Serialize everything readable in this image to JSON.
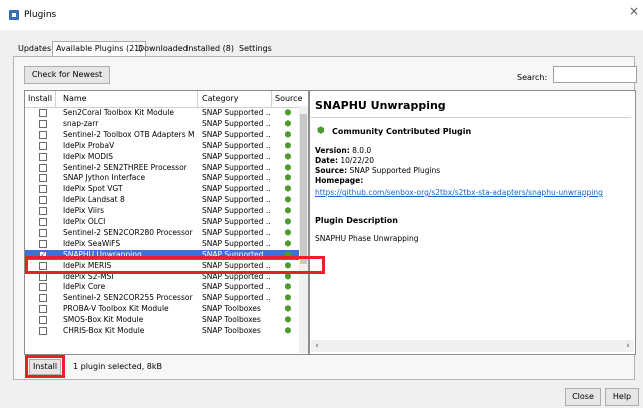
{
  "window": {
    "title": "Plugins",
    "close_glyph": "×"
  },
  "tabs": [
    {
      "label": "Updates"
    },
    {
      "label": "Available Plugins (21)"
    },
    {
      "label": "Downloaded"
    },
    {
      "label": "Installed (8)"
    },
    {
      "label": "Settings"
    }
  ],
  "toolbar": {
    "check_label": "Check for Newest",
    "search_label": "Search:",
    "search_value": ""
  },
  "table": {
    "headers": {
      "install": "Install",
      "name": "Name",
      "category": "Category",
      "source": "Source"
    },
    "rows": [
      {
        "name": "Sen2Coral Toolbox Kit Module",
        "category": "SNAP Supported ...",
        "checked": false
      },
      {
        "name": "snap-zarr",
        "category": "SNAP Supported ...",
        "checked": false
      },
      {
        "name": "Sentinel-2 Toolbox OTB Adapters M...",
        "category": "SNAP Supported ...",
        "checked": false
      },
      {
        "name": "IdePix ProbaV",
        "category": "SNAP Supported ...",
        "checked": false
      },
      {
        "name": "IdePix MODIS",
        "category": "SNAP Supported ...",
        "checked": false
      },
      {
        "name": "Sentinel-2 SEN2THREE Processor",
        "category": "SNAP Supported ...",
        "checked": false
      },
      {
        "name": "SNAP Jython Interface",
        "category": "SNAP Supported ...",
        "checked": false
      },
      {
        "name": "IdePix Spot VGT",
        "category": "SNAP Supported ...",
        "checked": false
      },
      {
        "name": "IdePix Landsat 8",
        "category": "SNAP Supported ...",
        "checked": false
      },
      {
        "name": "IdePix Viirs",
        "category": "SNAP Supported ...",
        "checked": false
      },
      {
        "name": "IdePix OLCI",
        "category": "SNAP Supported ...",
        "checked": false
      },
      {
        "name": "Sentinel-2 SEN2COR280 Processor",
        "category": "SNAP Supported ...",
        "checked": false
      },
      {
        "name": "IdePix SeaWiFS",
        "category": "SNAP Supported ...",
        "checked": false
      },
      {
        "name": "SNAPHU Unwrapping",
        "category": "SNAP Supported ...",
        "checked": true,
        "selected": true
      },
      {
        "name": "IdePix MERIS",
        "category": "SNAP Supported ...",
        "checked": false
      },
      {
        "name": "IdePix S2-MSI",
        "category": "SNAP Supported ...",
        "checked": false
      },
      {
        "name": "IdePix Core",
        "category": "SNAP Supported ...",
        "checked": false
      },
      {
        "name": "Sentinel-2 SEN2COR255 Processor",
        "category": "SNAP Supported ...",
        "checked": false
      },
      {
        "name": "PROBA-V Toolbox Kit Module",
        "category": "SNAP Toolboxes",
        "checked": false
      },
      {
        "name": "SMOS-Box Kit Module",
        "category": "SNAP Toolboxes",
        "checked": false
      },
      {
        "name": "CHRIS-Box Kit Module",
        "category": "SNAP Toolboxes",
        "checked": false
      }
    ]
  },
  "details": {
    "title": "SNAPHU Unwrapping",
    "contrib_label": "Community Contributed Plugin",
    "version_label": "Version:",
    "version": "8.0.0",
    "date_label": "Date:",
    "date": "10/22/20",
    "source_label": "Source:",
    "source": "SNAP Supported Plugins",
    "homepage_label": "Homepage:",
    "homepage_url": "https://github.com/senbox-org/s2tbx/s2tbx-sta-adapters/snaphu-unwrapping",
    "desc_title": "Plugin Description",
    "description": "SNAPHU Phase Unwrapping"
  },
  "footer": {
    "install_label": "Install",
    "status": "1 plugin selected, 8kB",
    "close_label": "Close",
    "help_label": "Help"
  },
  "colors": {
    "selection": "#3d71d9",
    "highlight": "#e8202a",
    "link": "#1f5fd1",
    "source_icon": "#4f9a2e"
  },
  "icons": {
    "app": "plugin-window-icon",
    "source": "puzzle-icon",
    "contrib": "puzzle-icon"
  }
}
